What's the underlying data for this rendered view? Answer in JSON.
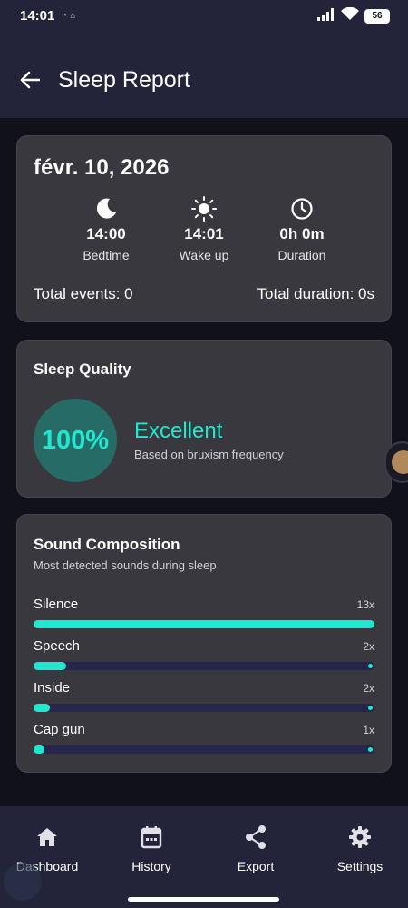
{
  "status_bar": {
    "time": "14:01",
    "battery": "56"
  },
  "app_bar": {
    "title": "Sleep Report"
  },
  "summary": {
    "date": "févr. 10, 2026",
    "bedtime": {
      "value": "14:00",
      "label": "Bedtime"
    },
    "wake_up": {
      "value": "14:01",
      "label": "Wake up"
    },
    "duration": {
      "value": "0h 0m",
      "label": "Duration"
    },
    "total_events": "Total events: 0",
    "total_duration": "Total duration: 0s"
  },
  "quality": {
    "title": "Sleep Quality",
    "percent": "100%",
    "label": "Excellent",
    "subtitle": "Based on bruxism frequency"
  },
  "sound": {
    "title": "Sound Composition",
    "subtitle": "Most detected sounds during sleep",
    "items": [
      {
        "name": "Silence",
        "count": "13x",
        "fraction": 1.0
      },
      {
        "name": "Speech",
        "count": "2x",
        "fraction": 0.096
      },
      {
        "name": "Inside",
        "count": "2x",
        "fraction": 0.048
      },
      {
        "name": "Cap gun",
        "count": "1x",
        "fraction": 0.03
      }
    ]
  },
  "nav": {
    "items": [
      {
        "label": "Dashboard",
        "icon": "home-icon"
      },
      {
        "label": "History",
        "icon": "calendar-icon"
      },
      {
        "label": "Export",
        "icon": "share-icon"
      },
      {
        "label": "Settings",
        "icon": "gear-icon"
      }
    ]
  },
  "colors": {
    "accent": "#1de9d1",
    "card": "#38383e",
    "bar": "#232339"
  }
}
